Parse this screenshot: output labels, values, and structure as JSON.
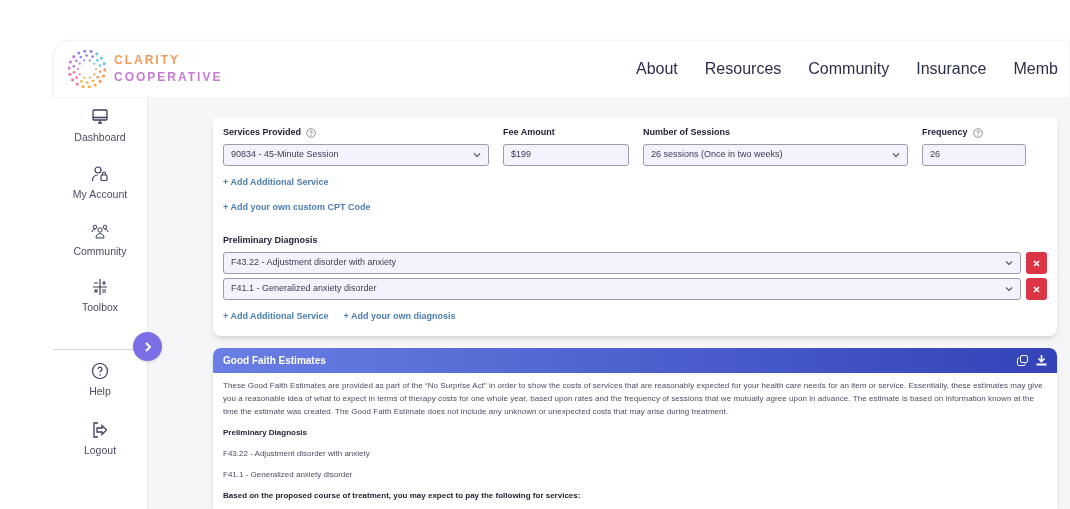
{
  "brand": {
    "line_1": "CLARITY",
    "line_2": "COOPERATIVE"
  },
  "nav": [
    "About",
    "Resources",
    "Community",
    "Insurance",
    "Memb"
  ],
  "sidebar": {
    "items": [
      {
        "label": "Dashboard",
        "kind": "monitor"
      },
      {
        "label": "My Account",
        "kind": "account"
      },
      {
        "label": "Community",
        "kind": "people"
      },
      {
        "label": "Toolbox",
        "kind": "toolbox"
      }
    ],
    "bottom_items": [
      {
        "label": "Help",
        "kind": "help"
      },
      {
        "label": "Logout",
        "kind": "logout"
      }
    ]
  },
  "form": {
    "services_label": "Services Provided",
    "service_value": "90834 - 45-Minute Session",
    "fee_label": "Fee Amount",
    "fee_value": "$199",
    "sessions_label": "Number of Sessions",
    "sessions_value": "26 sessions (Once in two weeks)",
    "frequency_label": "Frequency",
    "frequency_value": "26",
    "service_links": [
      "+ Add Additional Service",
      "+ Add your own custom CPT Code"
    ],
    "diagnosis_label": "Preliminary Diagnosis",
    "diagnoses": [
      "F43.22 - Adjustment disorder with anxiety",
      "F41.1 - Generalized anxiety disorder"
    ],
    "diagnosis_links": [
      "+ Add Additional Service",
      "+ Add your own diagnosis"
    ]
  },
  "estimates": {
    "title": "Good Faith Estimates",
    "intro": "These Good Faith Estimates are provided as part of the “No Surprise Act” in order to show the costs of services that are reasonably expected for your health care needs for an item or service. Essentially, these estimates may give you a reasonable idea of what to expect in terms of therapy costs for one whole year, based upon rates and the frequency of sessions that we mutually agree upon in advance. The estimate is based on information known at the time the estimate was created. The Good Faith Estimate does not include any unknown or unexpected costs that may arise during treatment.",
    "diagnosis_heading": "Preliminary Diagnosis",
    "diagnoses": [
      "F43.22 - Adjustment disorder with anxiety",
      "F41.1 - Generalized anxiety disorder"
    ],
    "services_heading": "Based on the proposed course of treatment, you may expect to pay the following for services:"
  }
}
